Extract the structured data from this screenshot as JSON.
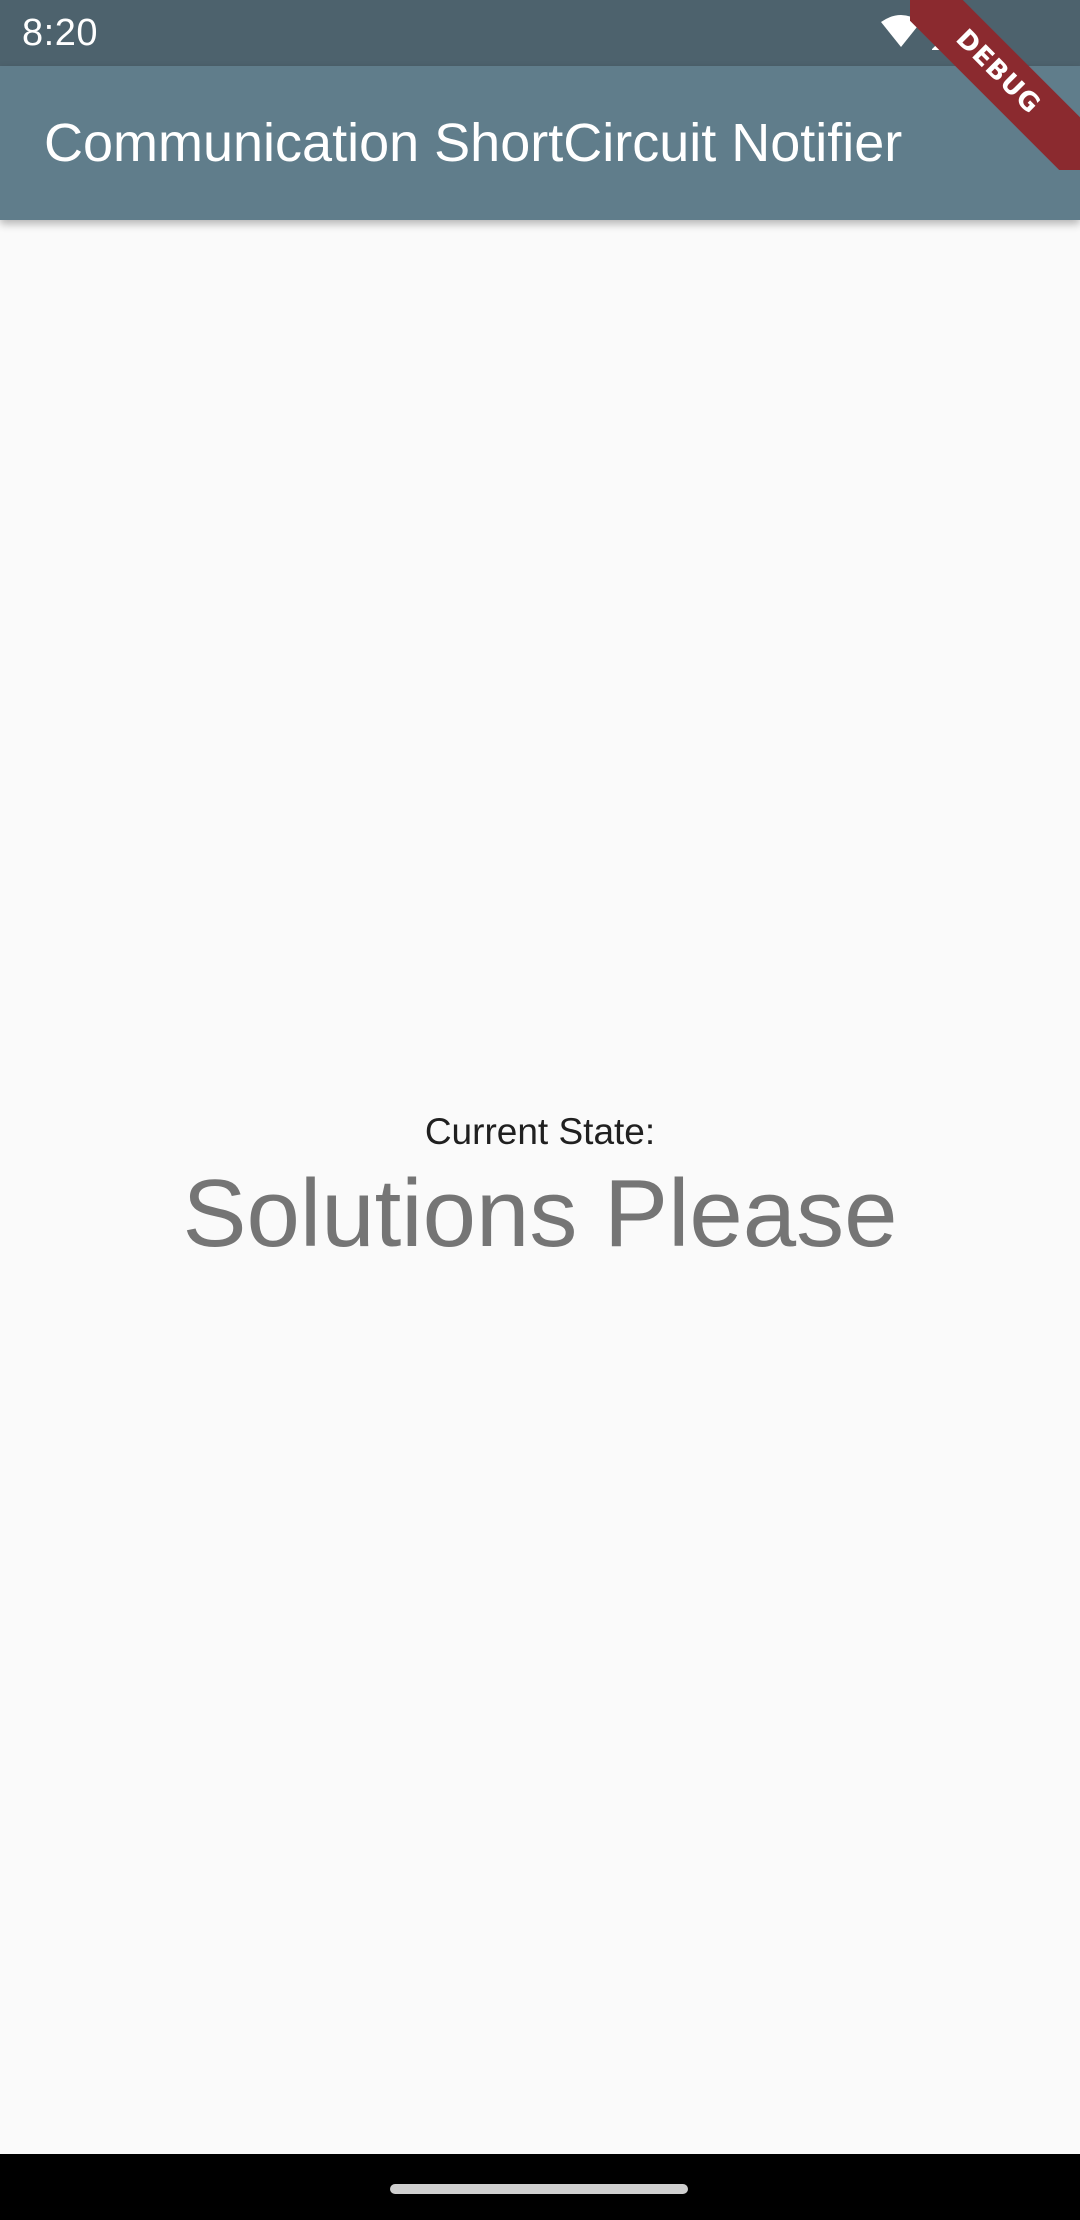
{
  "status_bar": {
    "time": "8:20",
    "icons": [
      "wifi-icon",
      "signal-icon"
    ]
  },
  "app_bar": {
    "title": "Communication ShortCircuit Notifier",
    "color": "#607d8b"
  },
  "debug_banner": {
    "label": "DEBUG",
    "color": "#8b2a2f"
  },
  "main": {
    "state_label": "Current State:",
    "state_value": "Solutions Please"
  },
  "colors": {
    "status_bar": "#4d626d",
    "background": "#fafafa",
    "state_value_text": "#757575"
  }
}
